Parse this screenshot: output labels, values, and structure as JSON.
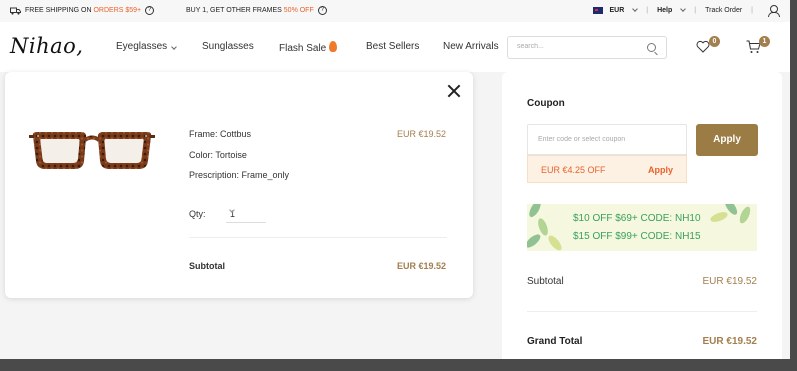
{
  "topbar": {
    "shipping_prefix": "FREE SHIPPING ON",
    "shipping_highlight": "ORDERS $59+",
    "bogo_prefix": "BUY 1, GET OTHER FRAMES",
    "bogo_highlight": "50% OFF",
    "currency": "EUR",
    "help": "Help",
    "track_order": "Track Order"
  },
  "header": {
    "logo": "Nihao,",
    "nav": {
      "eyeglasses": "Eyeglasses",
      "sunglasses": "Sunglasses",
      "flash_sale": "Flash Sale",
      "best_sellers": "Best Sellers",
      "new_arrivals": "New Arrivals"
    },
    "search_placeholder": "search...",
    "wishlist_count": "0",
    "cart_count": "1"
  },
  "cart_item": {
    "frame": "Frame: Cottbus",
    "color": "Color: Tortoise",
    "prescription": "Prescription: Frame_only",
    "price": "EUR €19.52",
    "qty_label": "Qty:",
    "qty_value": "1",
    "subtotal_label": "Subtotal",
    "subtotal_value": "EUR €19.52"
  },
  "coupon": {
    "title": "Coupon",
    "placeholder": "Enter code or select coupon",
    "apply_button": "Apply",
    "suggest_amount": "EUR €4.25 OFF",
    "suggest_apply": "Apply",
    "promo_line1": "$10 OFF $69+ CODE: NH10",
    "promo_line2": "$15 OFF $99+ CODE: NH15"
  },
  "summary": {
    "subtotal_label": "Subtotal",
    "subtotal_value": "EUR €19.52",
    "grand_total_label": "Grand Total",
    "grand_total_value": "EUR €19.52"
  },
  "colors": {
    "accent_gold": "#9b7c44",
    "promo_orange": "#e8622d",
    "promo_green": "#3aa05e"
  }
}
